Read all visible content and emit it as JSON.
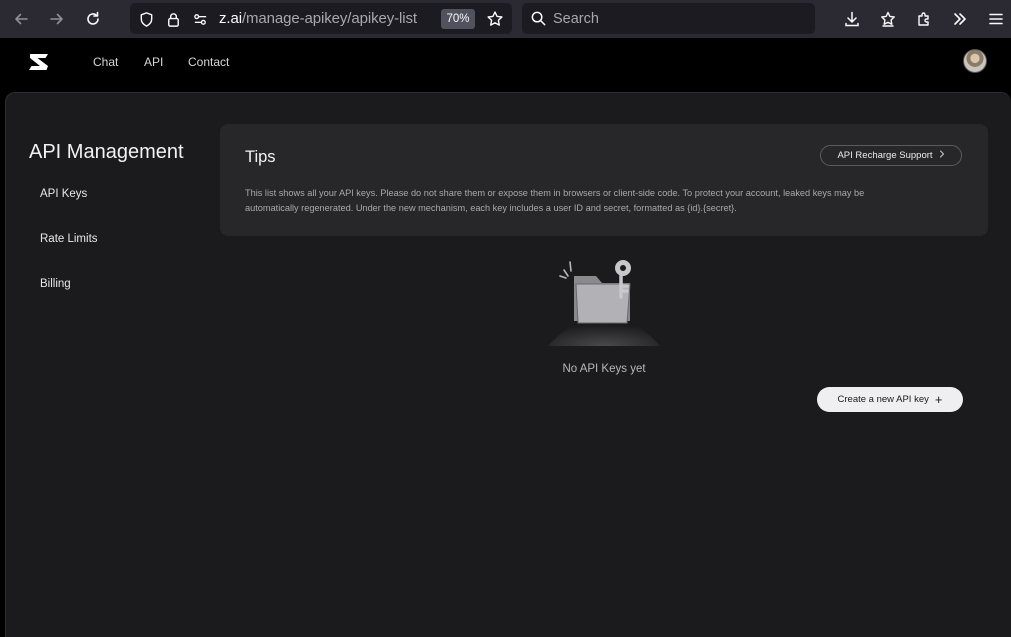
{
  "browser": {
    "url_host": "z.ai",
    "url_path": "/manage-apikey/apikey-list",
    "zoom": "70%",
    "search_placeholder": "Search"
  },
  "site": {
    "nav": [
      "Chat",
      "API",
      "Contact"
    ]
  },
  "sidebar": {
    "title": "API Management",
    "items": [
      {
        "label": "API Keys"
      },
      {
        "label": "Rate Limits"
      },
      {
        "label": "Billing"
      }
    ]
  },
  "tips": {
    "title": "Tips",
    "recharge_button": "API Recharge Support",
    "line1": "This list shows all your API keys. Please do not share them or expose them in browsers or client-side code. To protect your account, leaked keys may be",
    "line2": "automatically regenerated. Under the new mechanism, each key includes a user ID and secret, formatted as {id}.{secret}."
  },
  "empty_state": {
    "message": "No API Keys yet"
  },
  "create_button": {
    "label": "Create a new API key",
    "icon": "+"
  },
  "colors": {
    "page_bg": "#000000",
    "panel_bg": "#1b1b1d",
    "card_bg": "#27272a",
    "primary_button_bg": "#efeff1"
  }
}
